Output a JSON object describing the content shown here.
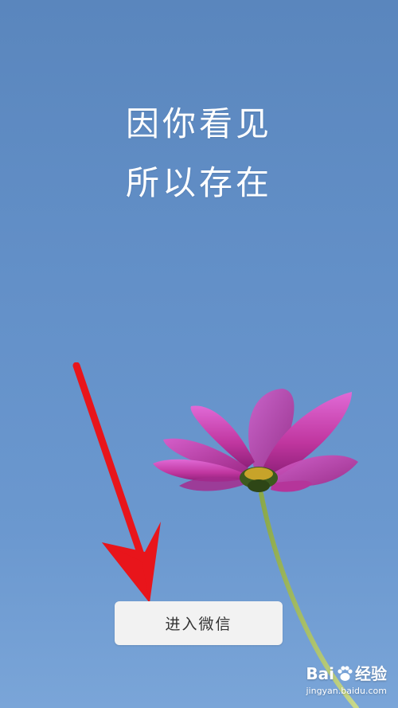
{
  "splash": {
    "slogan_line1": "因你看见",
    "slogan_line2": "所以存在",
    "background_color": "#6390c8"
  },
  "enter_button": {
    "label": "进入微信"
  },
  "annotation": {
    "arrow_color": "#e8151b"
  },
  "watermark": {
    "brand_left": "Bai",
    "brand_right": "经验",
    "url": "jingyan.baidu.com"
  }
}
